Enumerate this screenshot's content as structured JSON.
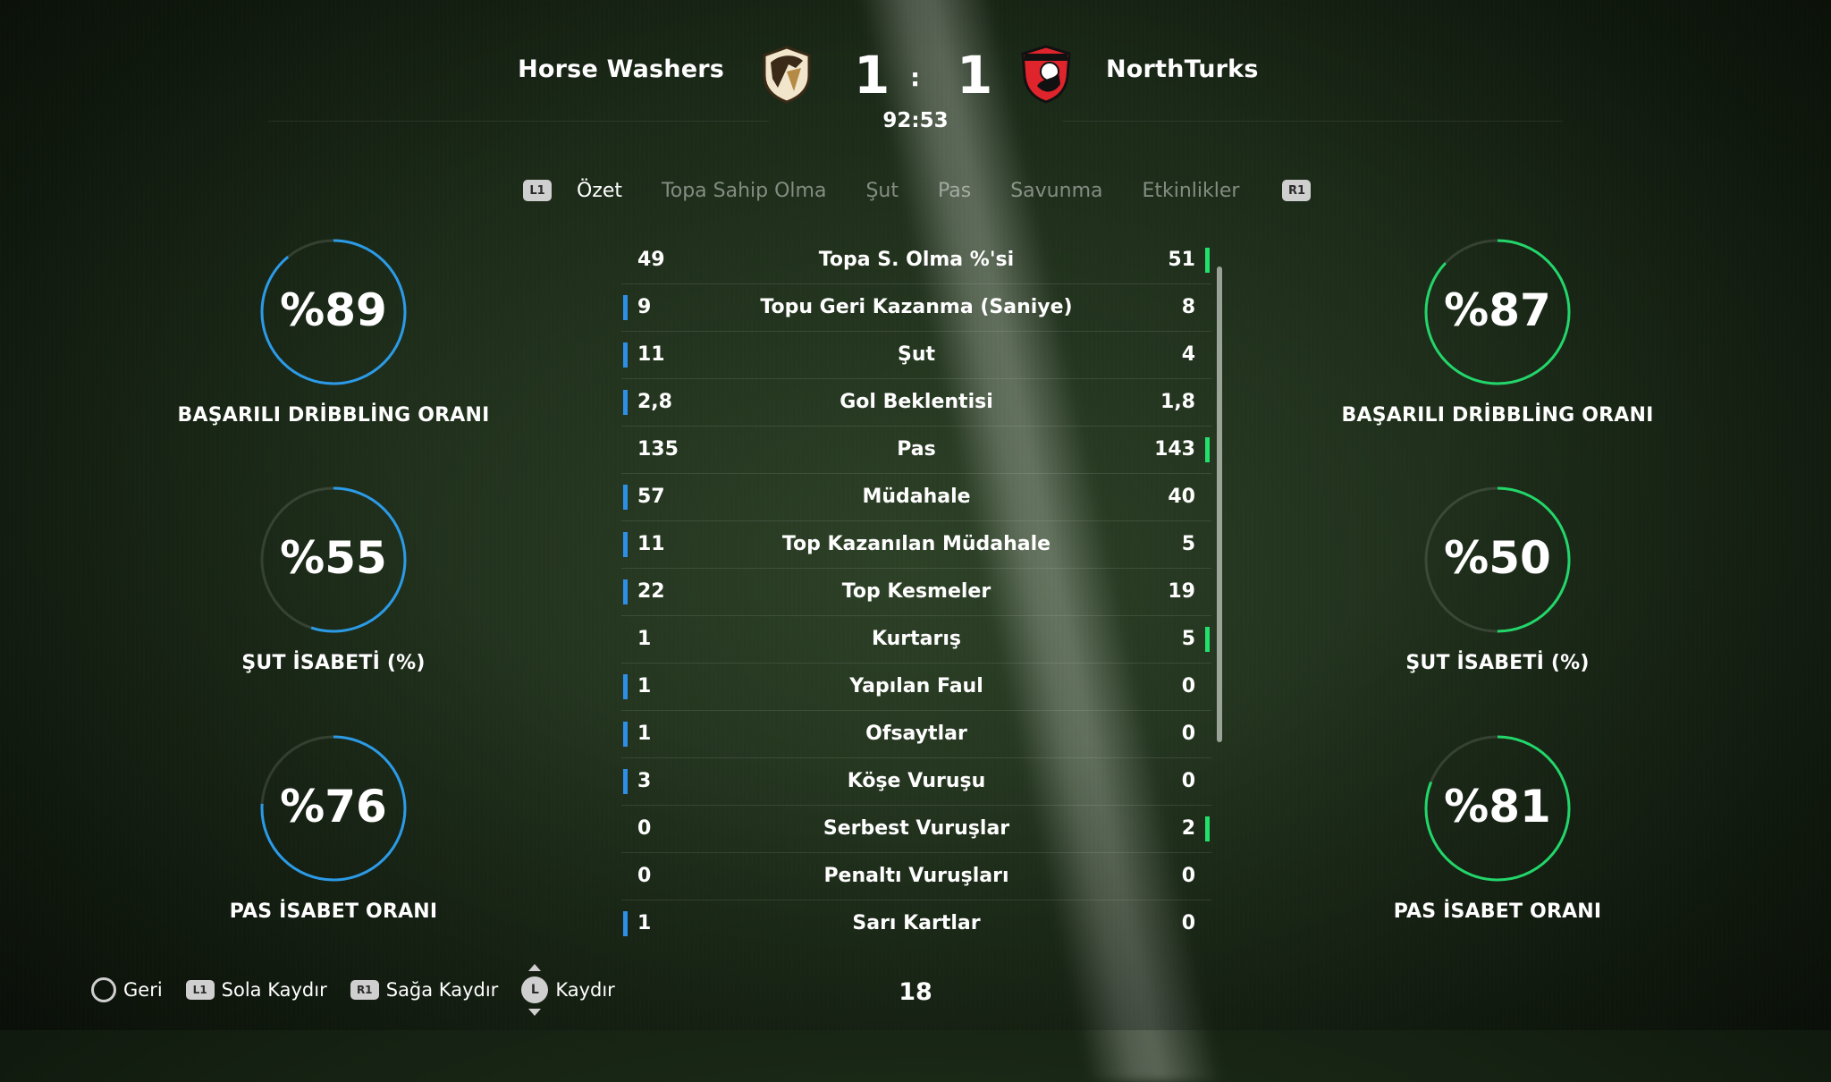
{
  "match": {
    "home_team": "Horse Washers",
    "away_team": "NorthTurks",
    "home_score": "1",
    "away_score": "1",
    "separator": ":",
    "clock": "92:53"
  },
  "tabs": {
    "l1": "L1",
    "r1": "R1",
    "items": [
      "Özet",
      "Topa Sahip Olma",
      "Şut",
      "Pas",
      "Savunma",
      "Etkinlikler"
    ],
    "active": "Özet"
  },
  "rings": {
    "home": [
      {
        "value_text": "%89",
        "fraction": 0.89,
        "label": "BAŞARILI DRİBBLİNG ORANI"
      },
      {
        "value_text": "%55",
        "fraction": 0.55,
        "label": "ŞUT İSABETİ (%)"
      },
      {
        "value_text": "%76",
        "fraction": 0.76,
        "label": "PAS İSABET ORANI"
      }
    ],
    "away": [
      {
        "value_text": "%87",
        "fraction": 0.87,
        "label": "BAŞARILI DRİBBLİNG ORANI"
      },
      {
        "value_text": "%50",
        "fraction": 0.5,
        "label": "ŞUT İSABETİ (%)"
      },
      {
        "value_text": "%81",
        "fraction": 0.81,
        "label": "PAS İSABET ORANI"
      }
    ],
    "home_color": "#2b9be8",
    "away_color": "#22d66a"
  },
  "stats": [
    {
      "home": "49",
      "label": "Topa S. Olma %'si",
      "away": "51",
      "leader": "away"
    },
    {
      "home": "9",
      "label": "Topu Geri Kazanma (Saniye)",
      "away": "8",
      "leader": "home"
    },
    {
      "home": "11",
      "label": "Şut",
      "away": "4",
      "leader": "home"
    },
    {
      "home": "2,8",
      "label": "Gol Beklentisi",
      "away": "1,8",
      "leader": "home"
    },
    {
      "home": "135",
      "label": "Pas",
      "away": "143",
      "leader": "away"
    },
    {
      "home": "57",
      "label": "Müdahale",
      "away": "40",
      "leader": "home"
    },
    {
      "home": "11",
      "label": "Top Kazanılan Müdahale",
      "away": "5",
      "leader": "home"
    },
    {
      "home": "22",
      "label": "Top Kesmeler",
      "away": "19",
      "leader": "home"
    },
    {
      "home": "1",
      "label": "Kurtarış",
      "away": "5",
      "leader": "away"
    },
    {
      "home": "1",
      "label": "Yapılan Faul",
      "away": "0",
      "leader": "home"
    },
    {
      "home": "1",
      "label": "Ofsaytlar",
      "away": "0",
      "leader": "home"
    },
    {
      "home": "3",
      "label": "Köşe Vuruşu",
      "away": "0",
      "leader": "home"
    },
    {
      "home": "0",
      "label": "Serbest Vuruşlar",
      "away": "2",
      "leader": "away"
    },
    {
      "home": "0",
      "label": "Penaltı Vuruşları",
      "away": "0",
      "leader": "none"
    },
    {
      "home": "1",
      "label": "Sarı Kartlar",
      "away": "0",
      "leader": "home"
    }
  ],
  "footer": {
    "back": "Geri",
    "l1_btn": "L1",
    "scroll_left": "Sola Kaydır",
    "r1_btn": "R1",
    "scroll_right": "Sağa Kaydır",
    "stick_btn": "L",
    "scroll": "Kaydır",
    "page_number": "18"
  }
}
